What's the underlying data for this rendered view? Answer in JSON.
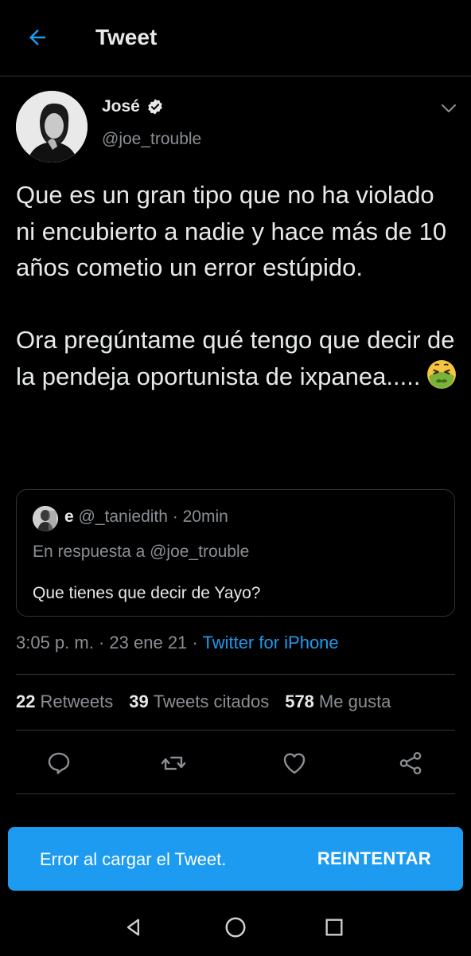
{
  "header": {
    "title": "Tweet",
    "back_icon": "arrow-left-icon"
  },
  "tweet": {
    "author_name": "José",
    "author_handle": "@joe_trouble",
    "verified": true,
    "paragraph_1": "Que es un gran tipo que no ha violado ni encubierto a nadie y hace más de 10 años cometio un error estúpido.",
    "paragraph_2": "Ora pregúntame qué tengo que decir de la pendeja oportunista de ixpanea.....",
    "emoji": "nauseated-face-emoji",
    "time": "3:05 p. m.",
    "date": "23 ene 21",
    "source": "Twitter for iPhone"
  },
  "quote": {
    "name": "e",
    "handle": "@_taniedith",
    "age": "20min",
    "reply_to": "En respuesta a @joe_trouble",
    "text": "Que tienes que decir de Yayo?"
  },
  "stats": {
    "retweets_count": "22",
    "retweets_label": "Retweets",
    "quotes_count": "39",
    "quotes_label": "Tweets citados",
    "likes_count": "578",
    "likes_label": "Me gusta"
  },
  "actions": [
    "reply-icon",
    "retweet-icon",
    "like-icon",
    "share-icon"
  ],
  "toast": {
    "message": "Error al cargar el Tweet.",
    "button": "REINTENTAR"
  },
  "colors": {
    "background": "#000000",
    "accent": "#1d9bf0",
    "text_primary": "#e7e9ea",
    "text_secondary": "#8b8f94",
    "divider": "#2f3336"
  }
}
